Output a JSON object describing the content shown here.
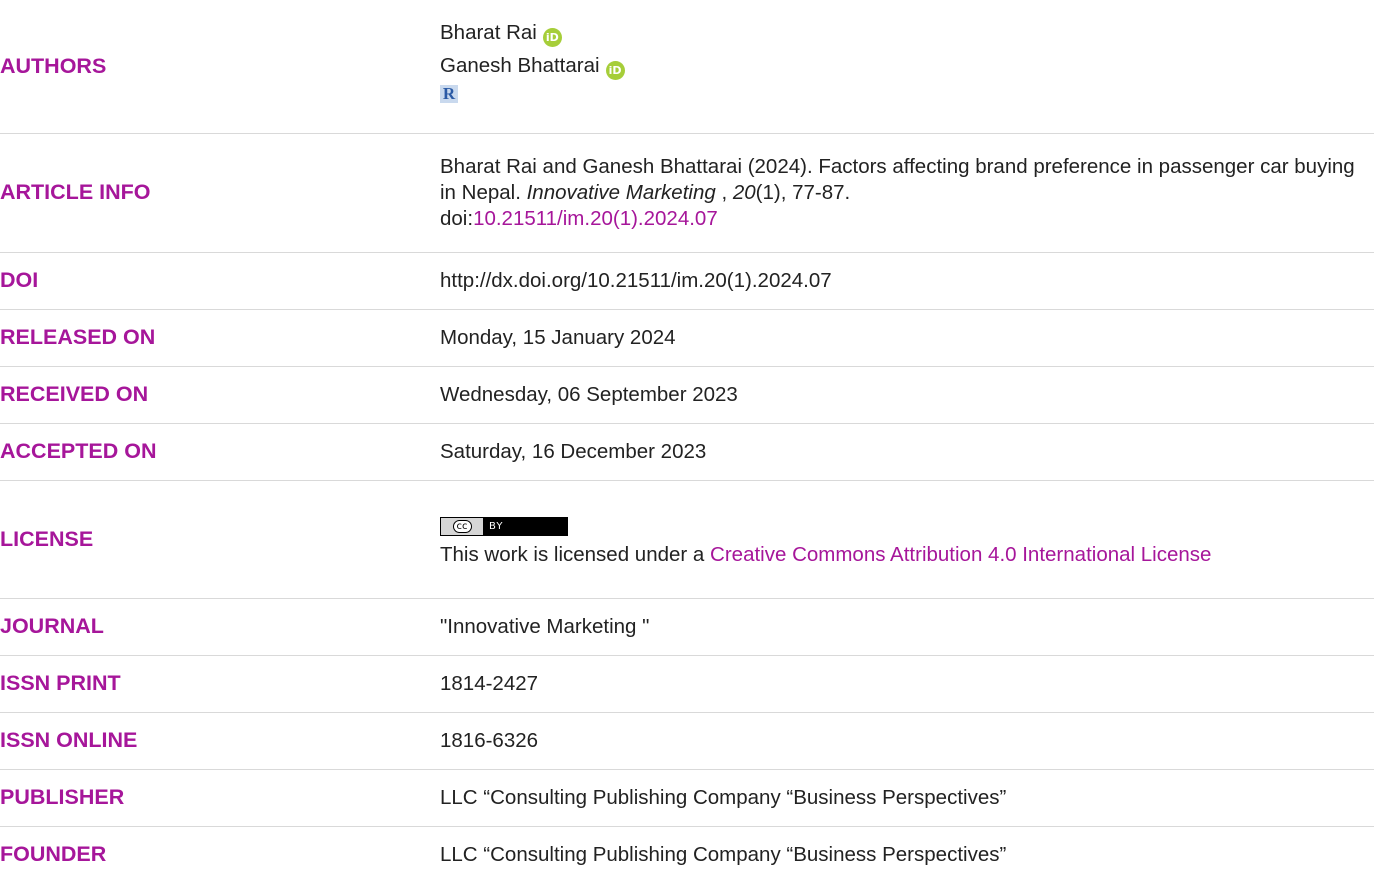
{
  "authors": {
    "label": "AUTHORS",
    "names": [
      "Bharat Rai",
      "Ganesh Bhattarai"
    ],
    "orcid_glyph": "iD",
    "researcher_glyph": "R"
  },
  "article_info": {
    "label": "ARTICLE INFO",
    "citation_prefix": "Bharat Rai and Ganesh Bhattarai (2024). Factors affecting brand preference in passenger car buying in Nepal. ",
    "journal_italic": "Innovative Marketing",
    "sep": " , ",
    "volume_italic": "20",
    "issue_pages": "(1), 77-87.",
    "doi_prefix": "doi:",
    "doi_link": "10.21511/im.20(1).2024.07"
  },
  "doi": {
    "label": "DOI",
    "value": "http://dx.doi.org/10.21511/im.20(1).2024.07"
  },
  "released": {
    "label": "RELEASED ON",
    "value": "Monday, 15 January 2024"
  },
  "received": {
    "label": "RECEIVED ON",
    "value": "Wednesday, 06 September 2023"
  },
  "accepted": {
    "label": "ACCEPTED ON",
    "value": "Saturday, 16 December 2023"
  },
  "license": {
    "label": "LICENSE",
    "badge_left": "cc",
    "badge_right": "BY",
    "text_prefix": "This work is licensed under a ",
    "link_text": "Creative Commons Attribution 4.0 International License"
  },
  "journal": {
    "label": "JOURNAL",
    "value": "\"Innovative Marketing \""
  },
  "issn_print": {
    "label": "ISSN PRINT",
    "value": "1814-2427"
  },
  "issn_online": {
    "label": "ISSN ONLINE",
    "value": "1816-6326"
  },
  "publisher": {
    "label": "PUBLISHER",
    "value": "LLC “Consulting Publishing Company “Business Perspectives”"
  },
  "founder": {
    "label": "FOUNDER",
    "value": "LLC “Consulting Publishing Company “Business Perspectives”"
  },
  "colors": {
    "label_accent": "#a6169a",
    "orcid_green": "#a6ce39",
    "divider": "#d9d9d9"
  }
}
